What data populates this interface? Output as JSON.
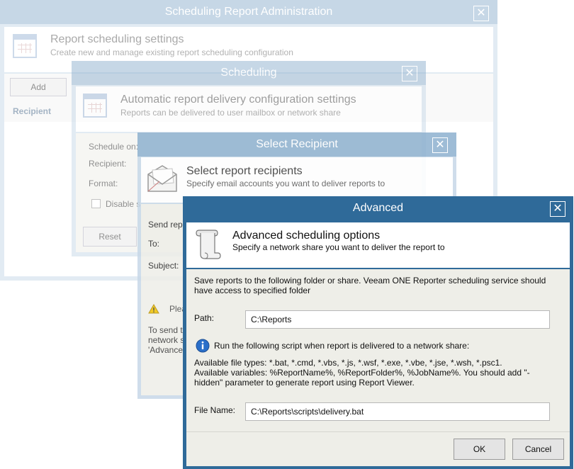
{
  "window1": {
    "title": "Scheduling Report Administration",
    "header_title": "Report scheduling settings",
    "header_subtitle": "Create new and manage existing report scheduling configuration",
    "add_label": "Add",
    "recipient_column": "Recipient"
  },
  "window2": {
    "title": "Scheduling",
    "header_title": "Automatic report delivery configuration settings",
    "header_subtitle": "Reports can be delivered to user mailbox or network share",
    "schedule_label": "Schedule on:",
    "recipient_label": "Recipient:",
    "format_label": "Format:",
    "disable_label": "Disable s",
    "reset_label": "Reset"
  },
  "window3": {
    "title": "Select Recipient",
    "header_title": "Select report recipients",
    "header_subtitle": "Specify email accounts you want to deliver reports to",
    "send_label": "Send repo",
    "to_label": "To:",
    "subject_label": "Subject:",
    "warning_text": "Plea",
    "note_line1": "To send t",
    "note_line2": "network s",
    "note_line3": "'Advanced"
  },
  "advanced": {
    "title": "Advanced",
    "header_title": "Advanced scheduling options",
    "header_subtitle": "Specify a network share you want to deliver the report to",
    "description": "Save reports to the following folder or share. Veeam ONE Reporter scheduling service should have access to specified folder",
    "path_label": "Path:",
    "path_value": "C:\\Reports",
    "script_info": "Run the following script when report is delivered to a network share:",
    "file_types": "Available file types: *.bat, *.cmd, *.vbs, *.js, *.wsf, *.exe, *.vbe, *.jse, *.wsh, *.psc1.",
    "variables": "Available variables: %ReportName%, %ReportFolder%, %JobName%. You should add \"-hidden\" parameter to generate report using Report Viewer.",
    "file_name_label": "File Name:",
    "file_name_value": "C:\\Reports\\scripts\\delivery.bat",
    "ok_label": "OK",
    "cancel_label": "Cancel"
  },
  "colors": {
    "active_title": "#2f6a99",
    "inactive_title": "#8eb1cf",
    "dialog_body": "#eeeee8"
  },
  "icons": [
    "calendar-icon",
    "envelope-icon",
    "scroll-icon",
    "info-icon",
    "warning-icon",
    "close-icon"
  ]
}
